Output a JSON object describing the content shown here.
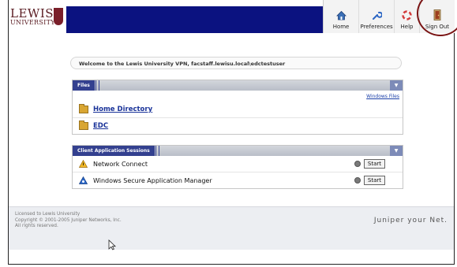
{
  "logo": {
    "line1": "LEWIS",
    "line2": "UNIVERSITY"
  },
  "nav": {
    "home": "Home",
    "preferences": "Preferences",
    "help": "Help",
    "sign_out": "Sign Out"
  },
  "welcome": "Welcome to the Lewis University VPN, facstaff.lewisu.local\\edctestuser",
  "files": {
    "title": "Files",
    "windows_files_link": "Windows Files",
    "items": [
      {
        "label": "Home Directory"
      },
      {
        "label": "EDC"
      }
    ]
  },
  "sessions": {
    "title": "Client Application Sessions",
    "items": [
      {
        "label": "Network Connect",
        "button": "Start"
      },
      {
        "label": "Windows Secure Application Manager",
        "button": "Start"
      }
    ]
  },
  "footer": {
    "line1": "Licensed to Lewis University",
    "line2": "Copyright © 2001-2005 Juniper Networks, Inc.",
    "line3": "All rights reserved.",
    "brand": "Juniper your Net."
  },
  "colors": {
    "nav_blue": "#0b1280",
    "panel_tab": "#33408f",
    "logo_maroon": "#5a1c22",
    "highlight_circle": "#7a1414"
  }
}
